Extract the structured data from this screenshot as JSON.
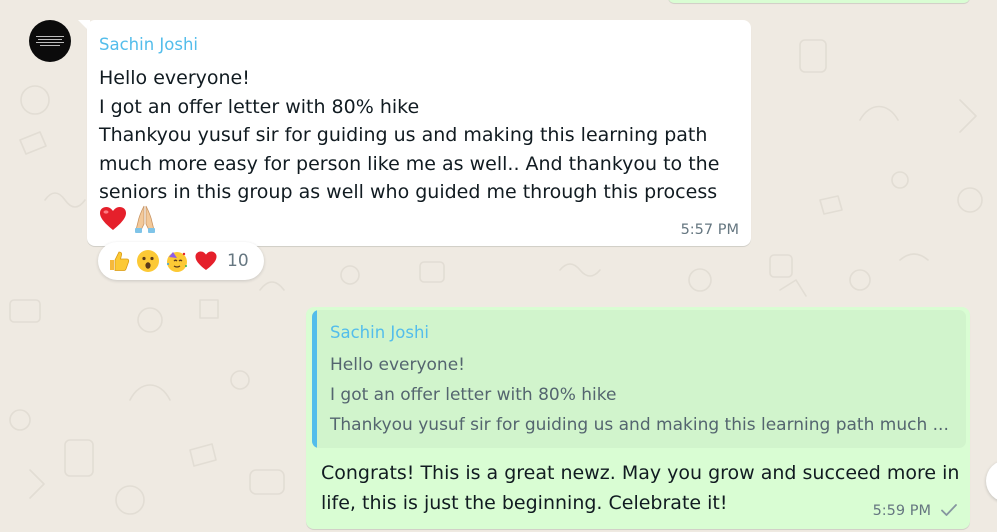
{
  "incoming": {
    "sender": "Sachin Joshi",
    "lines": [
      "Hello everyone!",
      "I got an offer letter with 80% hike",
      "Thankyou yusuf sir for guiding us and making this learning path",
      "much more easy for person like me as well.. And thankyou to the",
      "seniors in this group as well who guided me through this process"
    ],
    "emojis": [
      "red-heart-emoji",
      "folded-hands-emoji"
    ],
    "time": "5:57 PM",
    "reactions": {
      "emojis": [
        "thumbs-up-emoji",
        "surprised-face-emoji",
        "party-face-emoji",
        "red-heart-emoji"
      ],
      "count": "10"
    }
  },
  "outgoing": {
    "quote": {
      "sender": "Sachin Joshi",
      "lines": [
        "Hello everyone!",
        "I got an offer letter with 80% hike",
        "Thankyou yusuf sir for guiding us and making this learning path much ..."
      ]
    },
    "lines": [
      "Congrats! This is a great newz. May you grow and succeed more in",
      "life, this is just the beginning. Celebrate it!"
    ],
    "time": "5:59 PM",
    "status_icon": "single-check-icon"
  },
  "colors": {
    "chat_background": "#efeae2",
    "incoming_bubble": "#ffffff",
    "outgoing_bubble": "#d9fdd3",
    "quote_background": "#d1f4cc",
    "sender_name": "#53bdeb",
    "meta_text": "#667781",
    "message_text": "#111b21"
  }
}
